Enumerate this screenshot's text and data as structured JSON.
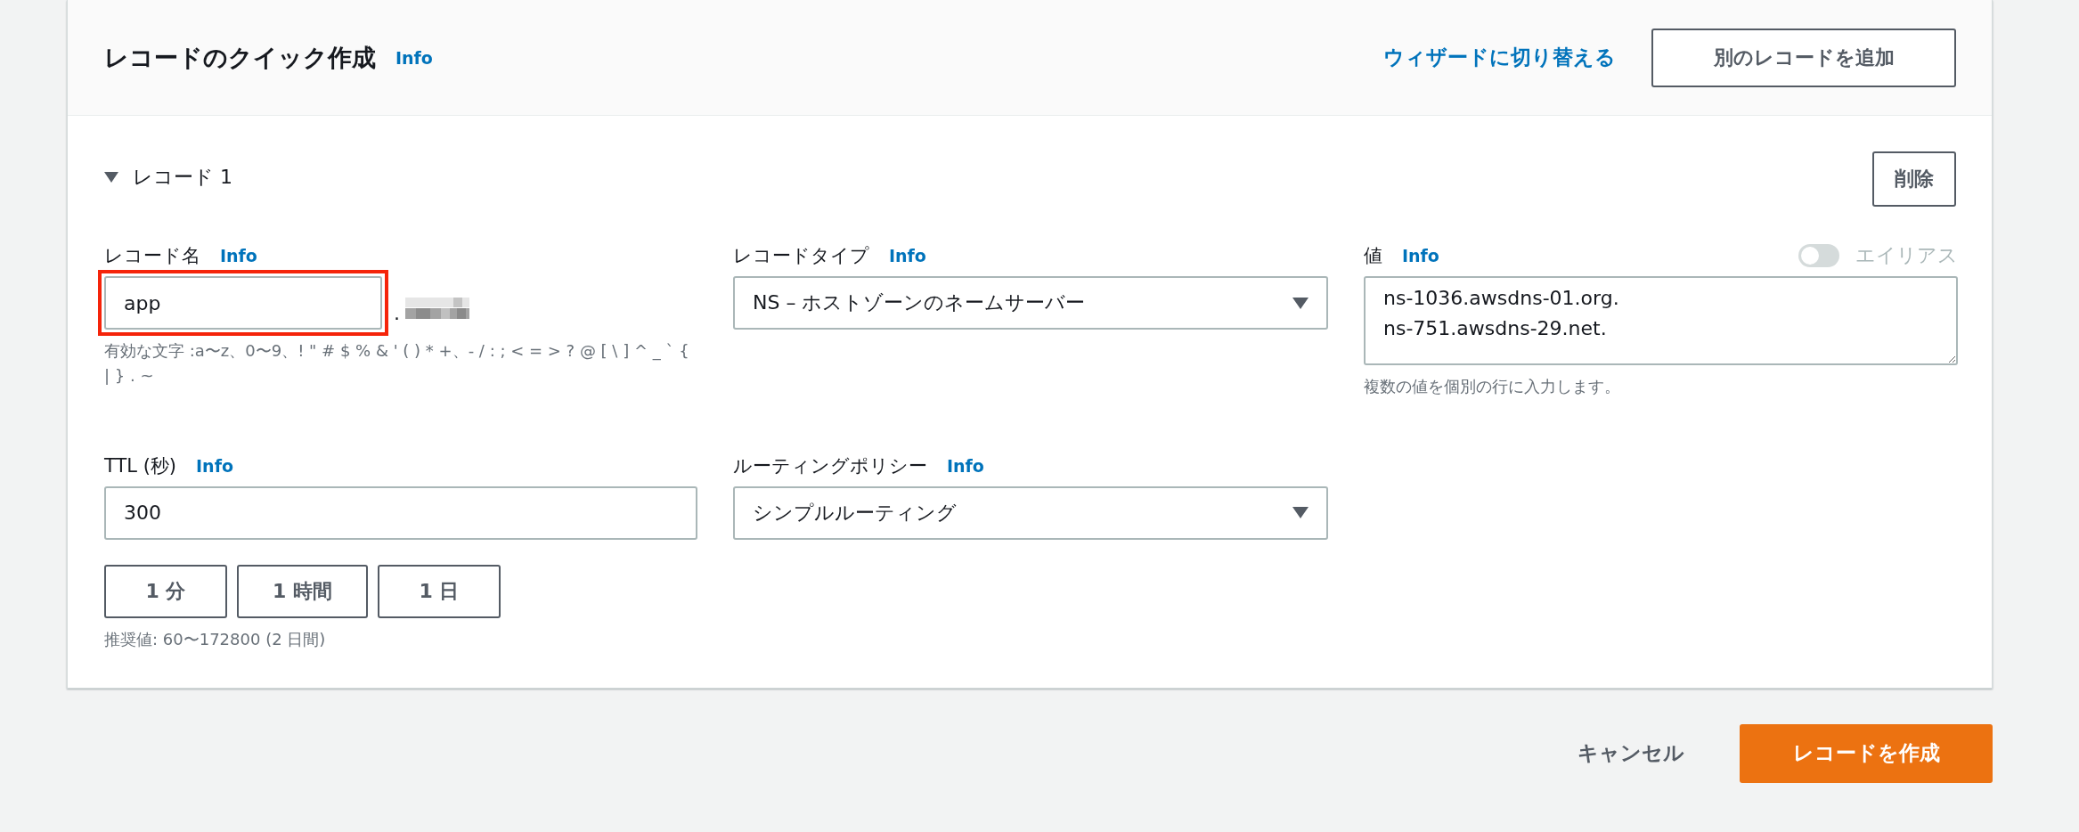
{
  "header": {
    "title": "レコードのクイック作成",
    "info": "Info",
    "switch_link": "ウィザードに切り替える",
    "add_button": "別のレコードを追加"
  },
  "record": {
    "title": "レコード 1",
    "expanded": true,
    "delete_button": "削除",
    "record_name": {
      "label": "レコード名",
      "info": "Info",
      "value": "app",
      "highlighted": true,
      "suffix": ".",
      "hint": "有効な文字 :a〜z、0〜9、! \" # $ % & ' ( ) * +、- / : ; < = > ? @ [ \\ ] ^ _ ` { | } . ~"
    },
    "record_type": {
      "label": "レコードタイプ",
      "info": "Info",
      "value": "NS – ホストゾーンのネームサーバー"
    },
    "value": {
      "label": "値",
      "info": "Info",
      "alias_toggle": {
        "label": "エイリアス",
        "on": false,
        "disabled": true
      },
      "lines": [
        "ns-1036.awsdns-01.org.",
        "ns-751.awsdns-29.net."
      ],
      "hint": "複数の値を個別の行に入力します。"
    },
    "ttl": {
      "label": "TTL (秒)",
      "info": "Info",
      "value": "300",
      "presets": [
        "1 分",
        "1 時間",
        "1 日"
      ],
      "hint": "推奨値: 60〜172800 (2 日間)"
    },
    "routing_policy": {
      "label": "ルーティングポリシー",
      "info": "Info",
      "value": "シンプルルーティング"
    }
  },
  "footer": {
    "cancel": "キャンセル",
    "create": "レコードを作成"
  }
}
